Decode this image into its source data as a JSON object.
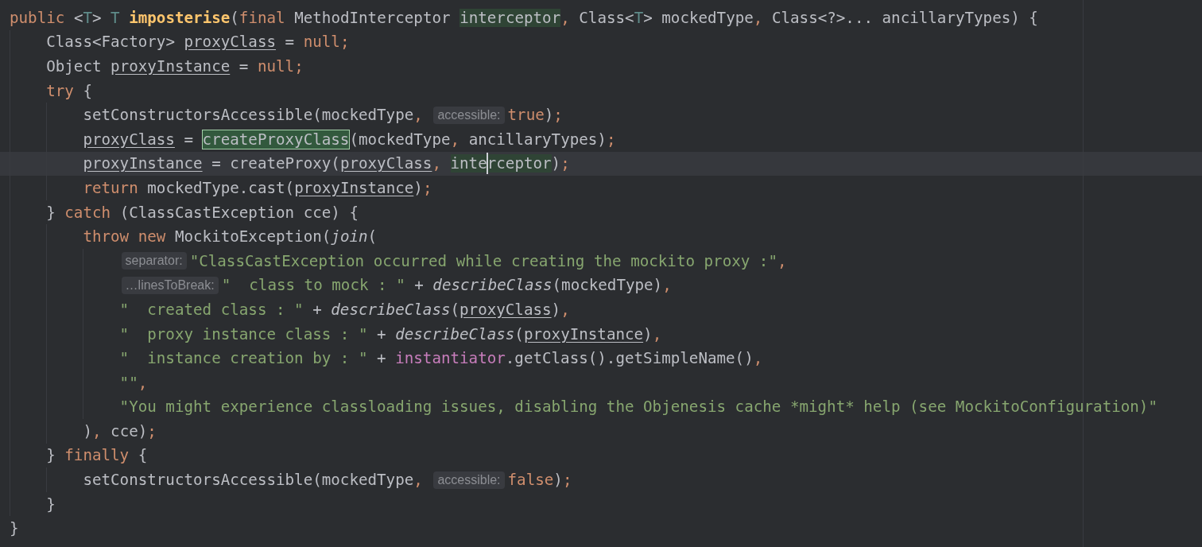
{
  "editor": {
    "lines": [
      {
        "tokens": [
          {
            "kind": "kw",
            "text": "public "
          },
          {
            "kind": "code",
            "text": "<"
          },
          {
            "kind": "tp",
            "text": "T"
          },
          {
            "kind": "code",
            "text": "> "
          },
          {
            "kind": "tp",
            "text": "T "
          },
          {
            "kind": "decl",
            "text": "imposterise"
          },
          {
            "kind": "code",
            "text": "("
          },
          {
            "kind": "kw",
            "text": "final"
          },
          {
            "kind": "code",
            "text": " MethodInterceptor "
          },
          {
            "kind": "code",
            "text": "interceptor",
            "usage_highlighted": true
          },
          {
            "kind": "kw",
            "text": ", "
          },
          {
            "kind": "code",
            "text": "Class<"
          },
          {
            "kind": "tp",
            "text": "T"
          },
          {
            "kind": "code",
            "text": "> mockedType"
          },
          {
            "kind": "kw",
            "text": ", "
          },
          {
            "kind": "code",
            "text": "Class<?>... ancillaryTypes) {"
          }
        ],
        "children": [
          {
            "tokens": [
              {
                "kind": "code",
                "text": "Class<Factory> "
              },
              {
                "kind": "local",
                "text": "proxyClass"
              },
              {
                "kind": "code",
                "text": " = "
              },
              {
                "kind": "kw",
                "text": "null;"
              }
            ]
          },
          {
            "tokens": [
              {
                "kind": "code",
                "text": "Object "
              },
              {
                "kind": "local",
                "text": "proxyInstance"
              },
              {
                "kind": "code",
                "text": " = "
              },
              {
                "kind": "kw",
                "text": "null;"
              }
            ]
          },
          {
            "tokens": [
              {
                "kind": "kw",
                "text": "try"
              },
              {
                "kind": "code",
                "text": " {"
              }
            ],
            "children": [
              {
                "tokens": [
                  {
                    "kind": "code",
                    "text": "setConstructorsAccessible(mockedType"
                  },
                  {
                    "kind": "kw",
                    "text": ", "
                  },
                  {
                    "kind": "hint",
                    "text": "accessible:"
                  },
                  {
                    "kind": "kw",
                    "text": "true"
                  },
                  {
                    "kind": "code",
                    "text": ")"
                  },
                  {
                    "kind": "kw",
                    "text": ";"
                  }
                ]
              },
              {
                "tokens": [
                  {
                    "kind": "local",
                    "text": "proxyClass"
                  },
                  {
                    "kind": "code",
                    "text": " = "
                  },
                  {
                    "kind": "code",
                    "text": "createProxyClass",
                    "search_matched": true
                  },
                  {
                    "kind": "code",
                    "text": "(mockedType"
                  },
                  {
                    "kind": "kw",
                    "text": ", "
                  },
                  {
                    "kind": "code",
                    "text": "ancillaryTypes)"
                  },
                  {
                    "kind": "kw",
                    "text": ";"
                  }
                ]
              },
              {
                "current": true,
                "tokens": [
                  {
                    "kind": "local",
                    "text": "proxyInstance"
                  },
                  {
                    "kind": "code",
                    "text": " = createProxy("
                  },
                  {
                    "kind": "local",
                    "text": "proxyClass"
                  },
                  {
                    "kind": "kw",
                    "text": ", "
                  },
                  {
                    "kind": "code",
                    "text": "inte",
                    "usage_highlighted": true,
                    "caret": true
                  },
                  {
                    "kind": "code",
                    "text": "rceptor",
                    "usage_highlighted": true
                  },
                  {
                    "kind": "code",
                    "text": ")"
                  },
                  {
                    "kind": "kw",
                    "text": ";"
                  }
                ]
              },
              {
                "tokens": [
                  {
                    "kind": "kw",
                    "text": "return "
                  },
                  {
                    "kind": "code",
                    "text": "mockedType.cast("
                  },
                  {
                    "kind": "local",
                    "text": "proxyInstance"
                  },
                  {
                    "kind": "code",
                    "text": ")"
                  },
                  {
                    "kind": "kw",
                    "text": ";"
                  }
                ]
              }
            ]
          },
          {
            "tokens": [
              {
                "kind": "code",
                "text": "} "
              },
              {
                "kind": "kw",
                "text": "catch"
              },
              {
                "kind": "code",
                "text": " (ClassCastException cce) {"
              }
            ],
            "children": [
              {
                "tokens": [
                  {
                    "kind": "kw",
                    "text": "throw new "
                  },
                  {
                    "kind": "code",
                    "text": "MockitoException("
                  },
                  {
                    "kind": "static",
                    "text": "join"
                  },
                  {
                    "kind": "code",
                    "text": "("
                  }
                ],
                "children": [
                  {
                    "tokens": [
                      {
                        "kind": "hint",
                        "text": "separator:"
                      },
                      {
                        "kind": "str",
                        "text": "\"ClassCastException occurred while creating the mockito proxy :\""
                      },
                      {
                        "kind": "kw",
                        "text": ","
                      }
                    ]
                  },
                  {
                    "tokens": [
                      {
                        "kind": "hint",
                        "text": "…linesToBreak:"
                      },
                      {
                        "kind": "str",
                        "text": "\"  class to mock : \""
                      },
                      {
                        "kind": "code",
                        "text": " + "
                      },
                      {
                        "kind": "static",
                        "text": "describeClass"
                      },
                      {
                        "kind": "code",
                        "text": "(mockedType)"
                      },
                      {
                        "kind": "kw",
                        "text": ","
                      }
                    ]
                  },
                  {
                    "tokens": [
                      {
                        "kind": "str",
                        "text": "\"  created class : \""
                      },
                      {
                        "kind": "code",
                        "text": " + "
                      },
                      {
                        "kind": "static",
                        "text": "describeClass"
                      },
                      {
                        "kind": "code",
                        "text": "("
                      },
                      {
                        "kind": "local",
                        "text": "proxyClass"
                      },
                      {
                        "kind": "code",
                        "text": ")"
                      },
                      {
                        "kind": "kw",
                        "text": ","
                      }
                    ]
                  },
                  {
                    "tokens": [
                      {
                        "kind": "str",
                        "text": "\"  proxy instance class : \""
                      },
                      {
                        "kind": "code",
                        "text": " + "
                      },
                      {
                        "kind": "static",
                        "text": "describeClass"
                      },
                      {
                        "kind": "code",
                        "text": "("
                      },
                      {
                        "kind": "local",
                        "text": "proxyInstance"
                      },
                      {
                        "kind": "code",
                        "text": ")"
                      },
                      {
                        "kind": "kw",
                        "text": ","
                      }
                    ]
                  },
                  {
                    "tokens": [
                      {
                        "kind": "str",
                        "text": "\"  instance creation by : \""
                      },
                      {
                        "kind": "code",
                        "text": " + "
                      },
                      {
                        "kind": "field",
                        "text": "instantiator"
                      },
                      {
                        "kind": "code",
                        "text": ".getClass().getSimpleName()"
                      },
                      {
                        "kind": "kw",
                        "text": ","
                      }
                    ]
                  },
                  {
                    "tokens": [
                      {
                        "kind": "str",
                        "text": "\"\""
                      },
                      {
                        "kind": "kw",
                        "text": ","
                      }
                    ]
                  },
                  {
                    "tokens": [
                      {
                        "kind": "str",
                        "text": "\"You might experience classloading issues, disabling the Objenesis cache *might* help (see MockitoConfiguration)\""
                      }
                    ]
                  }
                ]
              },
              {
                "tokens": [
                  {
                    "kind": "code",
                    "text": ")"
                  },
                  {
                    "kind": "kw",
                    "text": ", "
                  },
                  {
                    "kind": "code",
                    "text": "cce)"
                  },
                  {
                    "kind": "kw",
                    "text": ";"
                  }
                ]
              }
            ]
          },
          {
            "tokens": [
              {
                "kind": "code",
                "text": "} "
              },
              {
                "kind": "kw",
                "text": "finally"
              },
              {
                "kind": "code",
                "text": " {"
              }
            ],
            "children": [
              {
                "tokens": [
                  {
                    "kind": "code",
                    "text": "setConstructorsAccessible(mockedType"
                  },
                  {
                    "kind": "kw",
                    "text": ", "
                  },
                  {
                    "kind": "hint",
                    "text": "accessible:"
                  },
                  {
                    "kind": "kw",
                    "text": "false"
                  },
                  {
                    "kind": "code",
                    "text": ")"
                  },
                  {
                    "kind": "kw",
                    "text": ";"
                  }
                ]
              }
            ]
          },
          {
            "tokens": [
              {
                "kind": "code",
                "text": "}"
              }
            ]
          }
        ]
      },
      {
        "tokens": [
          {
            "kind": "code",
            "text": "}"
          }
        ]
      }
    ]
  }
}
